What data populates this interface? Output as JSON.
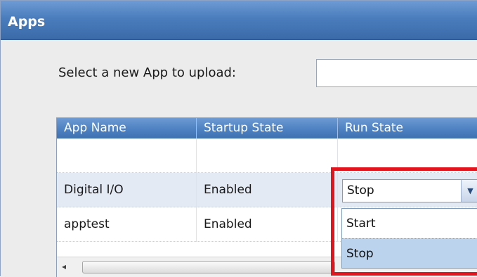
{
  "window": {
    "title": "Apps"
  },
  "upload": {
    "label": "Select a new App to upload:",
    "value": ""
  },
  "grid": {
    "columns": [
      "App Name",
      "Startup State",
      "Run State"
    ],
    "rows": [
      {
        "name": "",
        "startup": "",
        "run": ""
      },
      {
        "name": "Digital I/O",
        "startup": "Enabled",
        "run": "Stop"
      },
      {
        "name": "apptest",
        "startup": "Enabled",
        "run": ""
      }
    ]
  },
  "runstate_dropdown": {
    "current_value": "Stop",
    "options": [
      "Start",
      "Stop"
    ],
    "selected_option": "Stop",
    "chevron_icon": "chevron-down-icon"
  },
  "scrollbar": {
    "left_arrow_icon": "arrow-left-icon",
    "left_arrow_glyph": "◂"
  },
  "colors": {
    "title_bar": "#4a7dbd",
    "highlight": "#e0151d",
    "selected_option": "#bcd3ee",
    "alt_row": "#e3eaf4"
  }
}
